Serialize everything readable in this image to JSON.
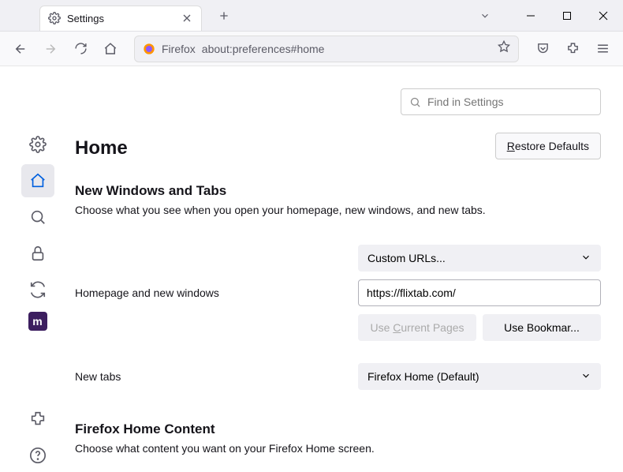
{
  "tab": {
    "title": "Settings"
  },
  "urlbar": {
    "brand": "Firefox",
    "address": "about:preferences#home"
  },
  "search": {
    "placeholder": "Find in Settings"
  },
  "page": {
    "title": "Home",
    "restore": "estore Defaults",
    "restore_prefix": "R"
  },
  "section1": {
    "title": "New Windows and Tabs",
    "desc": "Choose what you see when you open your homepage, new windows, and new tabs."
  },
  "form": {
    "homepage_label": "Homepage and new windows",
    "homepage_dropdown": "Custom URLs...",
    "homepage_url": "https://flixtab.com/",
    "use_current_prefix": "Use ",
    "use_current_u": "C",
    "use_current_suffix": "urrent Pages",
    "use_bookmark": "Use Bookmar...",
    "newtabs_label": "New tabs",
    "newtabs_dropdown": "Firefox Home (Default)"
  },
  "section2": {
    "title": "Firefox Home Content",
    "desc": "Choose what content you want on your Firefox Home screen."
  }
}
